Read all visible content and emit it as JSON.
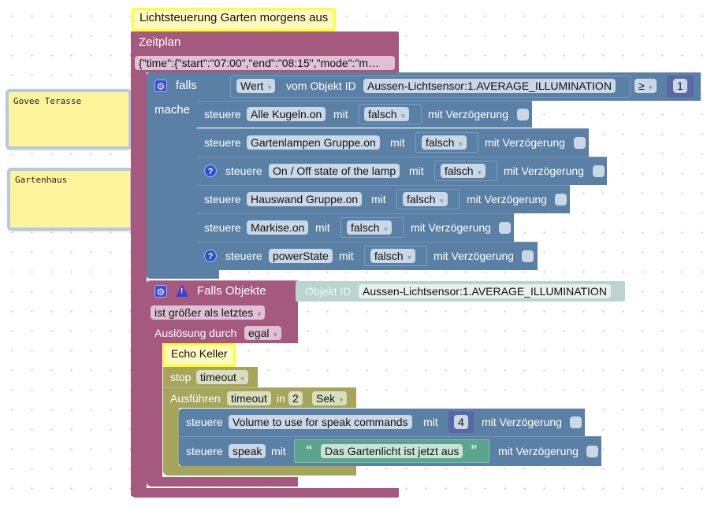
{
  "comments": [
    {
      "text": "Govee Terasse"
    },
    {
      "text": "Gartenhaus"
    }
  ],
  "schedule_block": {
    "comment_label": "Lichtsteuerung Garten morgens aus",
    "title": "Zeitplan",
    "schedule_value": "{\"time\":{\"start\":\"07:00\",\"end\":\"08:15\",\"mode\":\"m…"
  },
  "if_block": {
    "if_label": "falls",
    "do_label": "mache",
    "condition": {
      "value_dropdown": "Wert",
      "from_object_label": "vom Objekt ID",
      "object_id": "Aussen-Lichtsensor:1.AVERAGE_ILLUMINATION",
      "operator": "≥",
      "compare_value": "1"
    },
    "actions": [
      {
        "control_label": "steuere",
        "object": "Alle Kugeln.on",
        "with_label": "mit",
        "value": "falsch",
        "delay_label": "mit Verzögerung",
        "has_help": false
      },
      {
        "control_label": "steuere",
        "object": "Gartenlampen Gruppe.on",
        "with_label": "mit",
        "value": "falsch",
        "delay_label": "mit Verzögerung",
        "has_help": false
      },
      {
        "control_label": "steuere",
        "object": "On / Off state of the lamp",
        "with_label": "mit",
        "value": "falsch",
        "delay_label": "mit Verzögerung",
        "has_help": true
      },
      {
        "control_label": "steuere",
        "object": "Hauswand Gruppe.on",
        "with_label": "mit",
        "value": "falsch",
        "delay_label": "mit Verzögerung",
        "has_help": false
      },
      {
        "control_label": "steuere",
        "object": "Markise.on",
        "with_label": "mit",
        "value": "falsch",
        "delay_label": "mit Verzögerung",
        "has_help": false
      },
      {
        "control_label": "steuere",
        "object": "powerState",
        "with_label": "mit",
        "value": "falsch",
        "delay_label": "mit Verzögerung",
        "has_help": true
      }
    ]
  },
  "trigger_block": {
    "title": "Falls Objekte",
    "object_label": "Objekt ID",
    "object_id": "Aussen-Lichtsensor:1.AVERAGE_ILLUMINATION",
    "condition": "ist größer als letztes",
    "trigger_label": "Auslösung durch",
    "trigger_value": "egal"
  },
  "echo_block": {
    "comment_label": "Echo Keller",
    "stop_label": "stop",
    "stop_value": "timeout",
    "run_label": "Ausführen",
    "timeout_name": "timeout",
    "in_label": "in",
    "timeout_amount": "2",
    "timeout_unit": "Sek",
    "actions": [
      {
        "control_label": "steuere",
        "object": "Volume to use for speak commands",
        "with_label": "mit",
        "value": "4",
        "delay_label": "mit Verzögerung"
      },
      {
        "control_label": "steuere",
        "object": "speak",
        "with_label": "mit",
        "open_quote": "“",
        "value": "Das Gartenlicht ist jetzt aus",
        "close_quote": "”",
        "delay_label": "mit Verzögerung"
      }
    ]
  },
  "colors": {
    "event_block": "#a5597f",
    "control_block": "#5b80a5",
    "timeout_block": "#a5a55b",
    "text_block": "#5ba58c",
    "comment_bg": "#fef49c",
    "hat_comment_border": "#ffff2e"
  }
}
